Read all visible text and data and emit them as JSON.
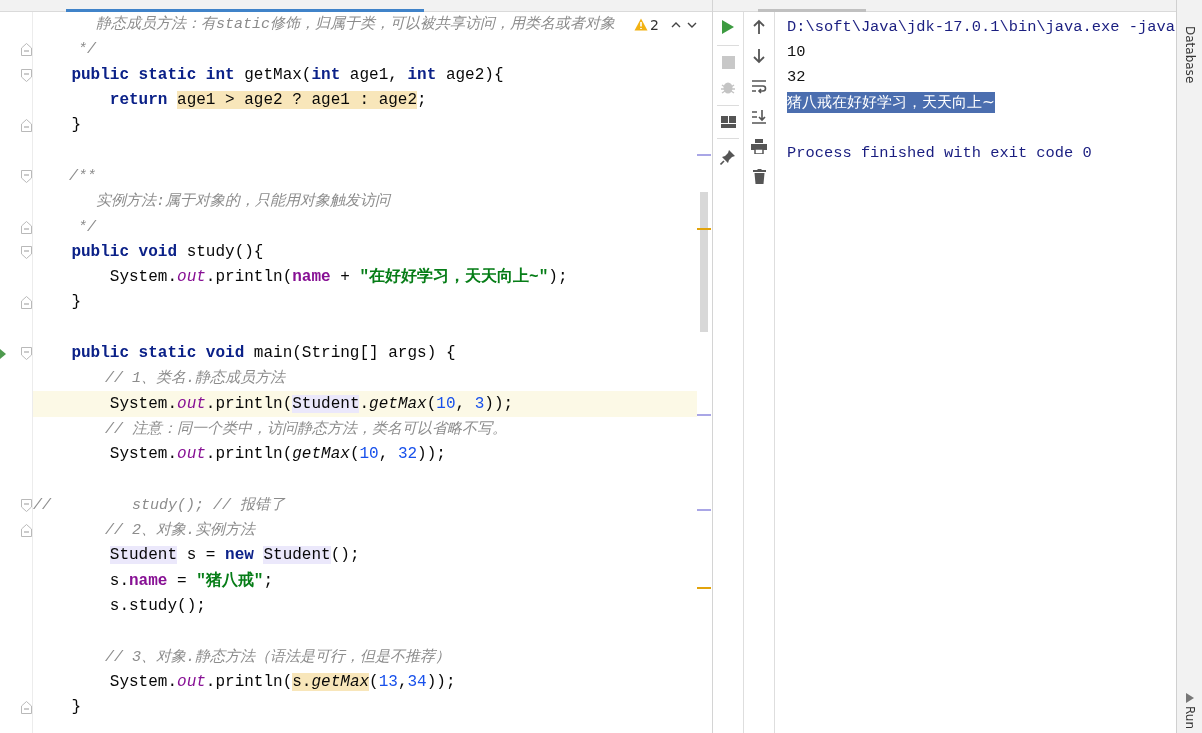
{
  "editor": {
    "inspection": {
      "count": "2"
    },
    "lines": [
      {
        "kind": "code",
        "tokens": [
          {
            "kind": "comment",
            "text": "       静态成员方法：有static修饰，归属于类，可以被共享访问，用类名或者对象"
          }
        ]
      },
      {
        "kind": "code",
        "fold": {
          "kind": "end"
        },
        "tokens": [
          {
            "kind": "comment",
            "text": "     */"
          }
        ]
      },
      {
        "kind": "code",
        "fold": {
          "kind": "start"
        },
        "tokens": [
          {
            "kind": "kw",
            "text": "    public static int "
          },
          {
            "kind": "plain",
            "text": "getMax("
          },
          {
            "kind": "kw",
            "text": "int "
          },
          {
            "kind": "plain",
            "text": "age1, "
          },
          {
            "kind": "kw",
            "text": "int "
          },
          {
            "kind": "plain",
            "text": "age2){"
          }
        ]
      },
      {
        "kind": "code",
        "tokens": [
          {
            "kind": "kw",
            "text": "        return "
          },
          {
            "kind": "plain",
            "text": "age1 > age2 ? age1 : age2",
            "highlight": {
              "kind": "warning"
            }
          },
          {
            "kind": "plain",
            "text": ";"
          }
        ]
      },
      {
        "kind": "code",
        "fold": {
          "kind": "end"
        },
        "tokens": [
          {
            "kind": "plain",
            "text": "    }"
          }
        ]
      },
      {
        "kind": "blank"
      },
      {
        "kind": "code",
        "fold": {
          "kind": "start"
        },
        "tokens": [
          {
            "kind": "comment",
            "text": "    /**"
          }
        ]
      },
      {
        "kind": "code",
        "tokens": [
          {
            "kind": "comment",
            "text": "       实例方法:属于对象的，只能用对象触发访问"
          }
        ]
      },
      {
        "kind": "code",
        "fold": {
          "kind": "end"
        },
        "tokens": [
          {
            "kind": "comment",
            "text": "     */"
          }
        ]
      },
      {
        "kind": "code",
        "fold": {
          "kind": "start"
        },
        "tokens": [
          {
            "kind": "kw",
            "text": "    public void "
          },
          {
            "kind": "plain",
            "text": "study(){"
          }
        ]
      },
      {
        "kind": "code",
        "tokens": [
          {
            "kind": "plain",
            "text": "        System."
          },
          {
            "kind": "static_field",
            "text": "out"
          },
          {
            "kind": "plain",
            "text": ".println("
          },
          {
            "kind": "field",
            "text": "name"
          },
          {
            "kind": "plain",
            "text": " + "
          },
          {
            "kind": "string",
            "text": "\"在好好学习，天天向上~\""
          },
          {
            "kind": "plain",
            "text": ");"
          }
        ]
      },
      {
        "kind": "code",
        "fold": {
          "kind": "end"
        },
        "tokens": [
          {
            "kind": "plain",
            "text": "    }"
          }
        ]
      },
      {
        "kind": "blank"
      },
      {
        "kind": "code",
        "fold": {
          "kind": "start"
        },
        "run": true,
        "tokens": [
          {
            "kind": "kw",
            "text": "    public static void "
          },
          {
            "kind": "plain",
            "text": "main(String[] args) {"
          }
        ]
      },
      {
        "kind": "code",
        "tokens": [
          {
            "kind": "comment",
            "text": "        // 1、类名.静态成员方法"
          }
        ]
      },
      {
        "kind": "code",
        "current": true,
        "tokens": [
          {
            "kind": "plain",
            "text": "        System."
          },
          {
            "kind": "static_field",
            "text": "out"
          },
          {
            "kind": "plain",
            "text": ".println("
          },
          {
            "kind": "plain",
            "text": "Student",
            "highlight": {
              "kind": "usage"
            }
          },
          {
            "kind": "plain",
            "text": "."
          },
          {
            "kind": "static_call",
            "text": "getMax"
          },
          {
            "kind": "plain",
            "text": "("
          },
          {
            "kind": "num",
            "text": "10"
          },
          {
            "kind": "plain",
            "text": ", "
          },
          {
            "kind": "num",
            "text": "3"
          },
          {
            "kind": "plain",
            "text": "));"
          }
        ]
      },
      {
        "kind": "code",
        "tokens": [
          {
            "kind": "comment",
            "text": "        // 注意：同一个类中，访问静态方法，类名可以省略不写。"
          }
        ]
      },
      {
        "kind": "code",
        "tokens": [
          {
            "kind": "plain",
            "text": "        System."
          },
          {
            "kind": "static_field",
            "text": "out"
          },
          {
            "kind": "plain",
            "text": ".println("
          },
          {
            "kind": "static_call",
            "text": "getMax"
          },
          {
            "kind": "plain",
            "text": "("
          },
          {
            "kind": "num",
            "text": "10"
          },
          {
            "kind": "plain",
            "text": ", "
          },
          {
            "kind": "num",
            "text": "32"
          },
          {
            "kind": "plain",
            "text": "));"
          }
        ]
      },
      {
        "kind": "blank"
      },
      {
        "kind": "code",
        "fold": {
          "kind": "start"
        },
        "tokens": [
          {
            "kind": "comment",
            "text": "//         study(); // 报错了"
          }
        ]
      },
      {
        "kind": "code",
        "fold": {
          "kind": "end"
        },
        "tokens": [
          {
            "kind": "comment",
            "text": "        // 2、对象.实例方法"
          }
        ]
      },
      {
        "kind": "code",
        "tokens": [
          {
            "kind": "plain",
            "text": "        Student",
            "highlight": {
              "kind": "usage"
            }
          },
          {
            "kind": "plain",
            "text": " s = "
          },
          {
            "kind": "kw",
            "text": "new "
          },
          {
            "kind": "plain",
            "text": "Student",
            "highlight": {
              "kind": "usage"
            }
          },
          {
            "kind": "plain",
            "text": "();"
          }
        ]
      },
      {
        "kind": "code",
        "tokens": [
          {
            "kind": "plain",
            "text": "        s."
          },
          {
            "kind": "field",
            "text": "name"
          },
          {
            "kind": "plain",
            "text": " = "
          },
          {
            "kind": "string",
            "text": "\"猪八戒\""
          },
          {
            "kind": "plain",
            "text": ";"
          }
        ]
      },
      {
        "kind": "code",
        "tokens": [
          {
            "kind": "plain",
            "text": "        s.study();"
          }
        ]
      },
      {
        "kind": "blank"
      },
      {
        "kind": "code",
        "tokens": [
          {
            "kind": "comment",
            "text": "        // 3、对象.静态方法（语法是可行，但是不推荐）"
          }
        ]
      },
      {
        "kind": "code",
        "tokens": [
          {
            "kind": "plain",
            "text": "        System."
          },
          {
            "kind": "static_field",
            "text": "out"
          },
          {
            "kind": "plain",
            "text": ".println("
          },
          {
            "kind": "plain",
            "text": "s.",
            "highlight": {
              "kind": "warning"
            }
          },
          {
            "kind": "static_call",
            "text": "getMax",
            "highlight": {
              "kind": "warning"
            }
          },
          {
            "kind": "plain",
            "text": "("
          },
          {
            "kind": "num",
            "text": "13"
          },
          {
            "kind": "plain",
            "text": ","
          },
          {
            "kind": "num",
            "text": "34"
          },
          {
            "kind": "plain",
            "text": "));"
          }
        ]
      },
      {
        "kind": "code",
        "fold": {
          "kind": "end"
        },
        "tokens": [
          {
            "kind": "plain",
            "text": "    }"
          }
        ]
      }
    ]
  },
  "console": {
    "lines": [
      {
        "kind": "command",
        "text": "D:\\soft\\Java\\jdk-17.0.1\\bin\\java.exe -java",
        "selected": false
      },
      {
        "kind": "output",
        "text": "10",
        "selected": false
      },
      {
        "kind": "output",
        "text": "32",
        "selected": false
      },
      {
        "kind": "output",
        "text": "猪八戒在好好学习，天天向上~",
        "selected": true
      },
      {
        "kind": "blank",
        "selected": false
      },
      {
        "kind": "exit",
        "text": "Process finished with exit code 0",
        "selected": false
      }
    ]
  },
  "side_tabs": [
    {
      "label": "Database"
    },
    {
      "label": "Run"
    }
  ]
}
